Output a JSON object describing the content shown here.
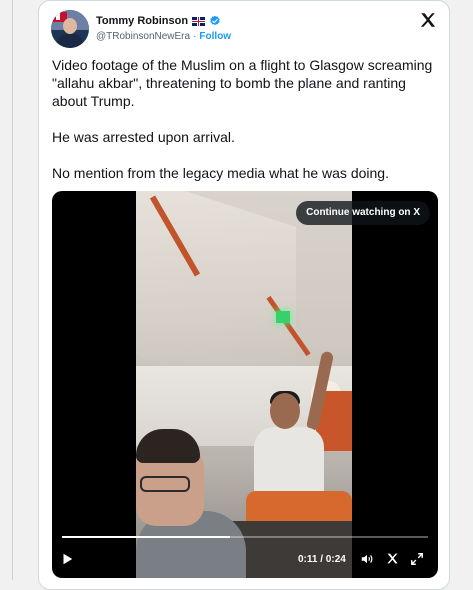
{
  "user": {
    "name": "Tommy Robinson",
    "handle": "@TRobinsonNewEra",
    "separator": "·",
    "follow_label": "Follow"
  },
  "tweet": {
    "paragraphs": [
      "Video footage of the Muslim on a flight to Glasgow screaming \"allahu akbar\", threatening to bomb the plane and ranting about Trump.",
      "He was arrested upon arrival.",
      "No mention from the legacy media what he was doing."
    ]
  },
  "video": {
    "continue_label": "Continue watching on X",
    "time": "0:11 / 0:24",
    "progress_fraction": 0.46
  },
  "icons": {
    "verified": "verified-badge-icon",
    "flag": "uk-flag-icon",
    "logo": "x-logo-icon",
    "play": "play-icon",
    "volume": "volume-icon",
    "fullscreen": "expand-icon"
  },
  "colors": {
    "accent": "#1d9bf0",
    "text": "#0f1419",
    "muted": "#536471"
  }
}
